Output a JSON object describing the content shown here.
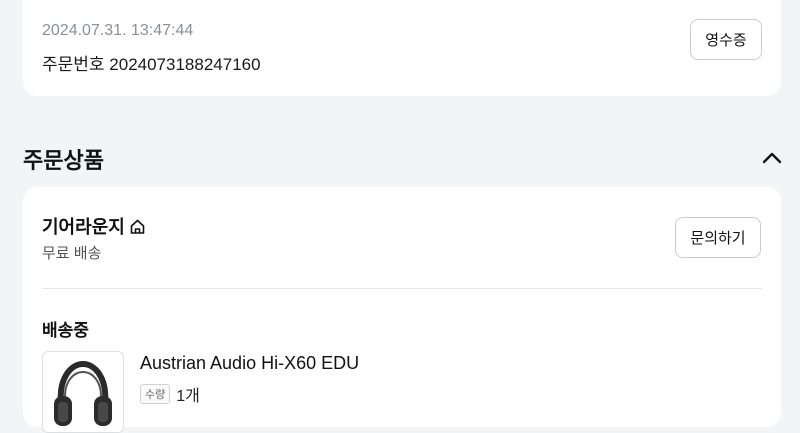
{
  "order": {
    "datetime": "2024.07.31. 13:47:44",
    "number_label": "주문번호 2024073188247160",
    "receipt_label": "영수증"
  },
  "section": {
    "title": "주문상품"
  },
  "shop": {
    "name": "기어라운지",
    "shipping": "무료 배송",
    "inquiry_label": "문의하기"
  },
  "item": {
    "status": "배송중",
    "name": "Austrian Audio Hi-X60 EDU",
    "qty_label": "수량",
    "qty_value": "1개"
  },
  "icons": {
    "shop": "home-icon",
    "collapse": "chevron-up-icon",
    "product": "headphones-image"
  }
}
